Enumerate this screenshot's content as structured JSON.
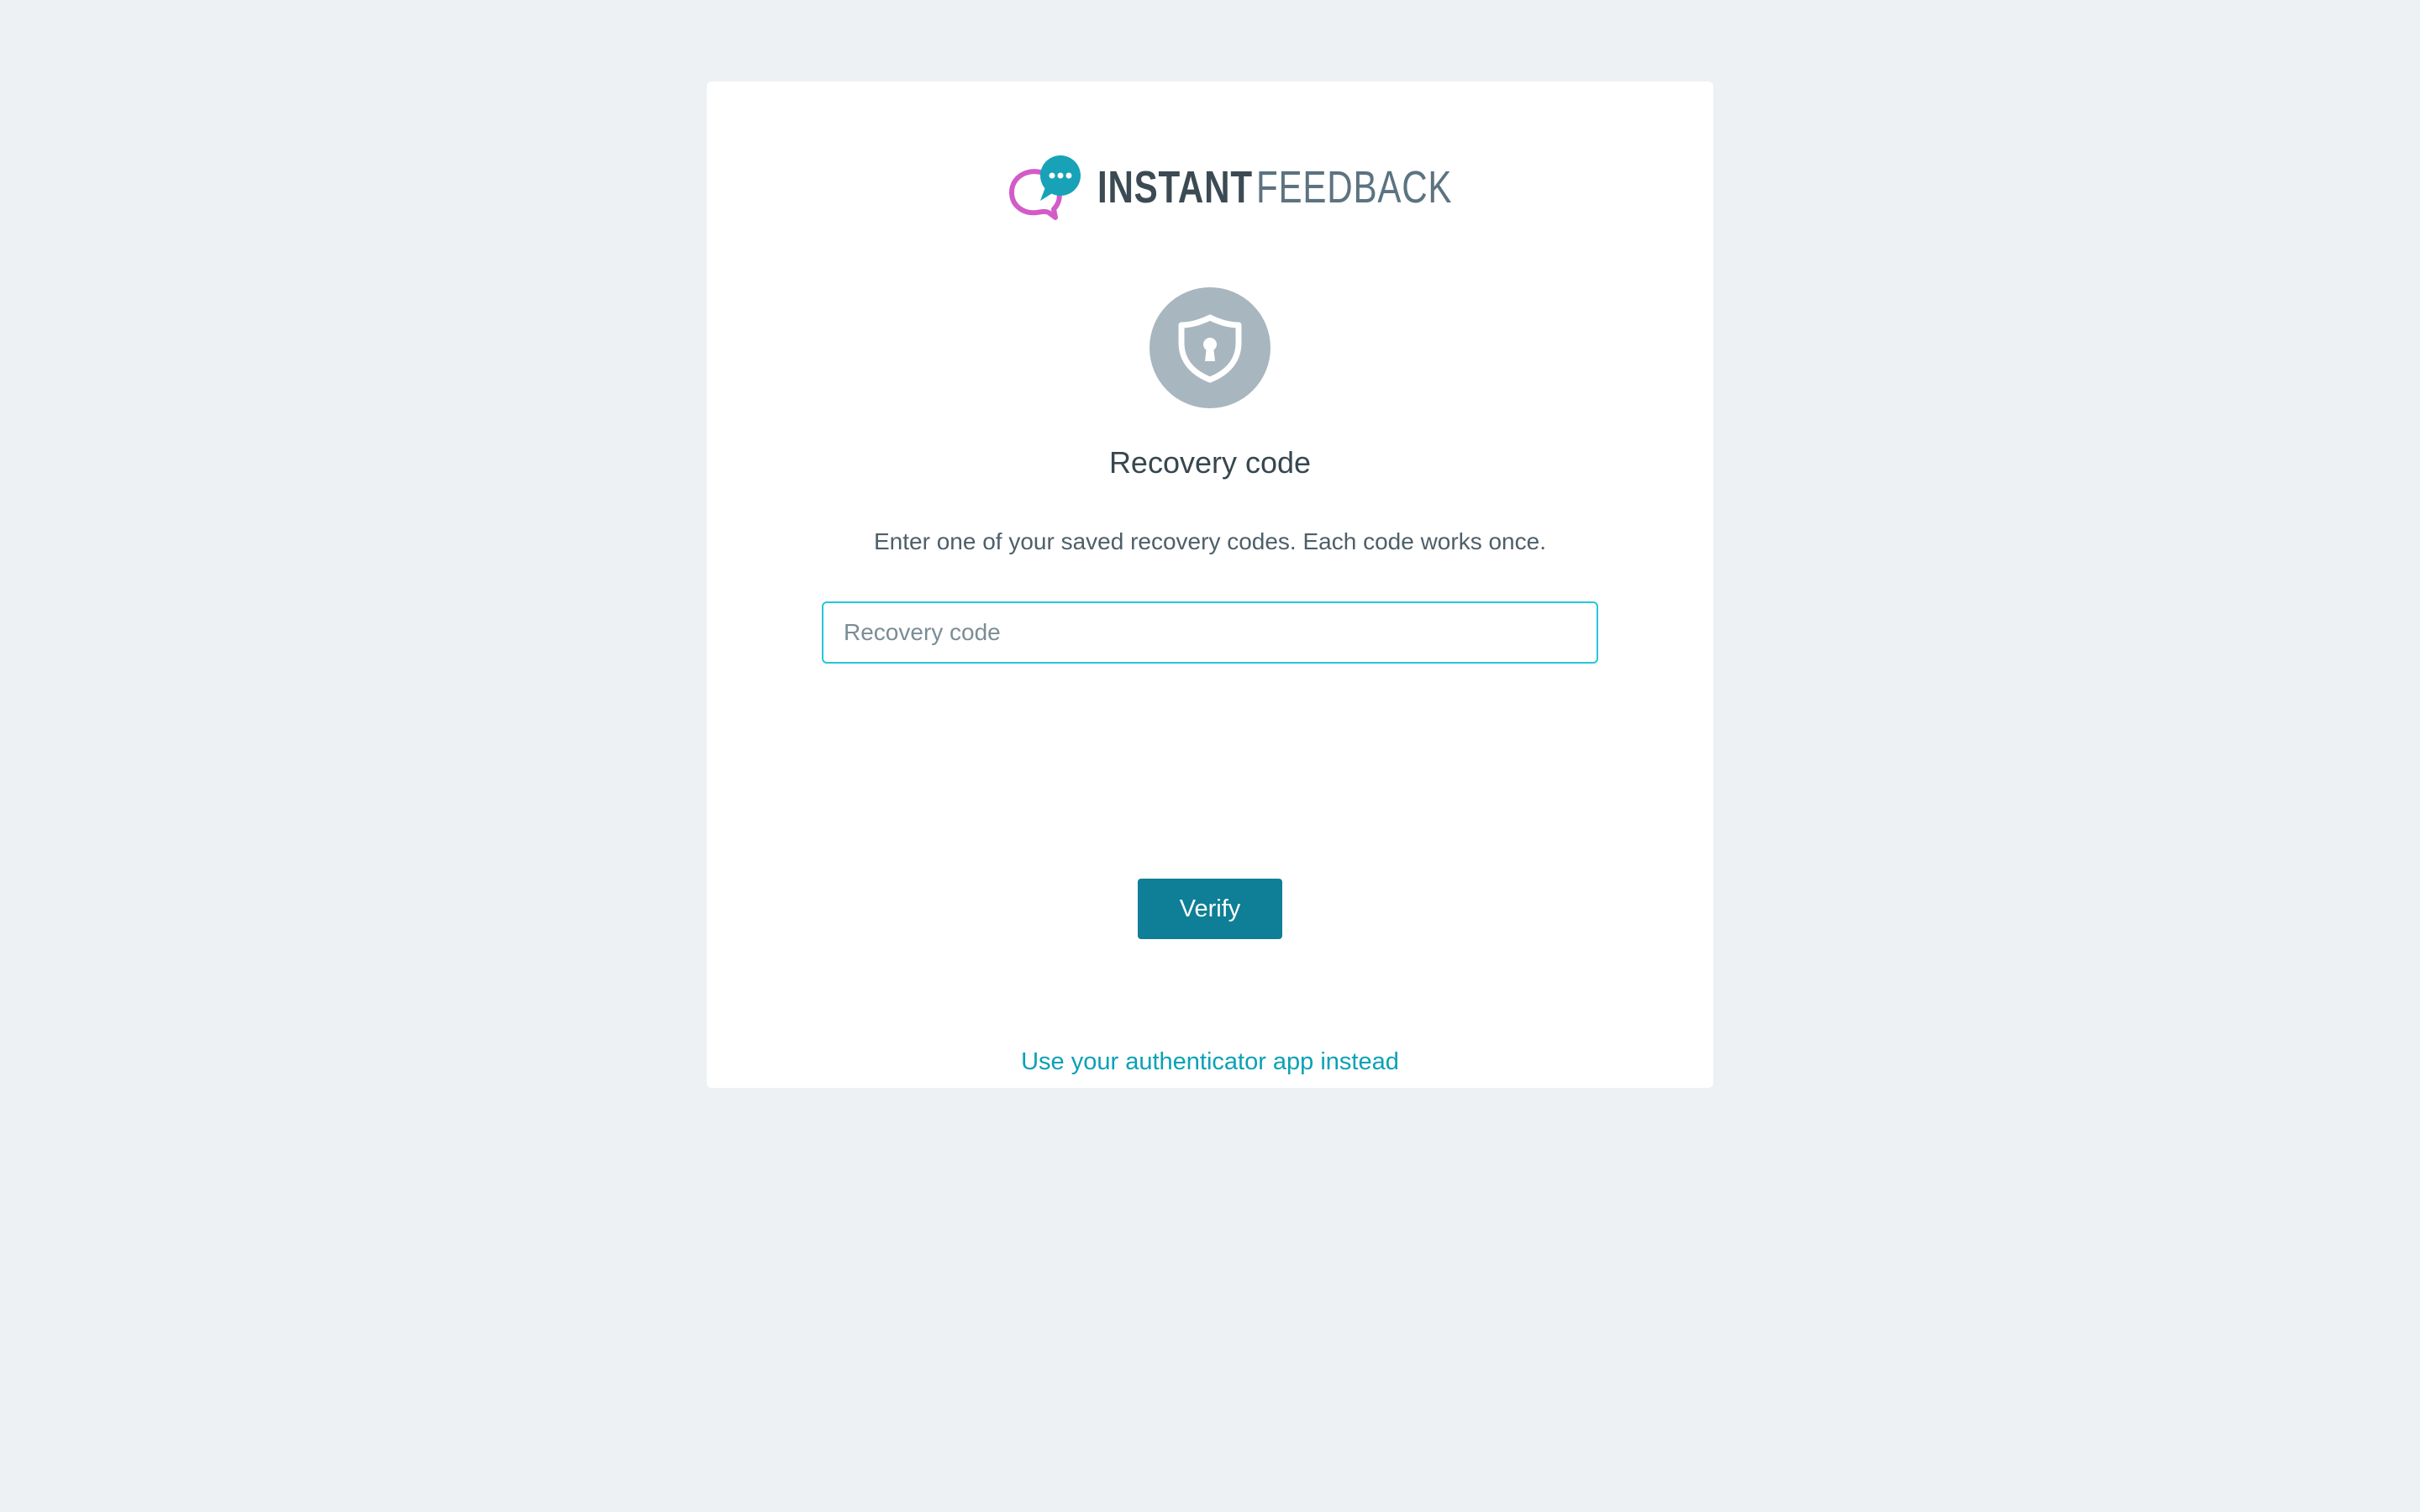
{
  "brand": {
    "name_part_1": "INSTANT",
    "name_part_2": "FEEDBACK",
    "logo_icon": "chat-bubbles-icon",
    "colors": {
      "bubble_outline": "#d35bc8",
      "bubble_fill": "#17a2b8"
    }
  },
  "security_icon": "shield-keyhole-icon",
  "page": {
    "title": "Recovery code",
    "description": "Enter one of your saved recovery codes. Each code works once."
  },
  "form": {
    "recovery_code": {
      "value": "",
      "placeholder": "Recovery code"
    },
    "verify_label": "Verify",
    "alt_link_label": "Use your authenticator app instead"
  },
  "colors": {
    "background": "#edf1f4",
    "accent": "#0e7f96",
    "link": "#0aa1b6",
    "input_focus_border": "#26c6da"
  }
}
